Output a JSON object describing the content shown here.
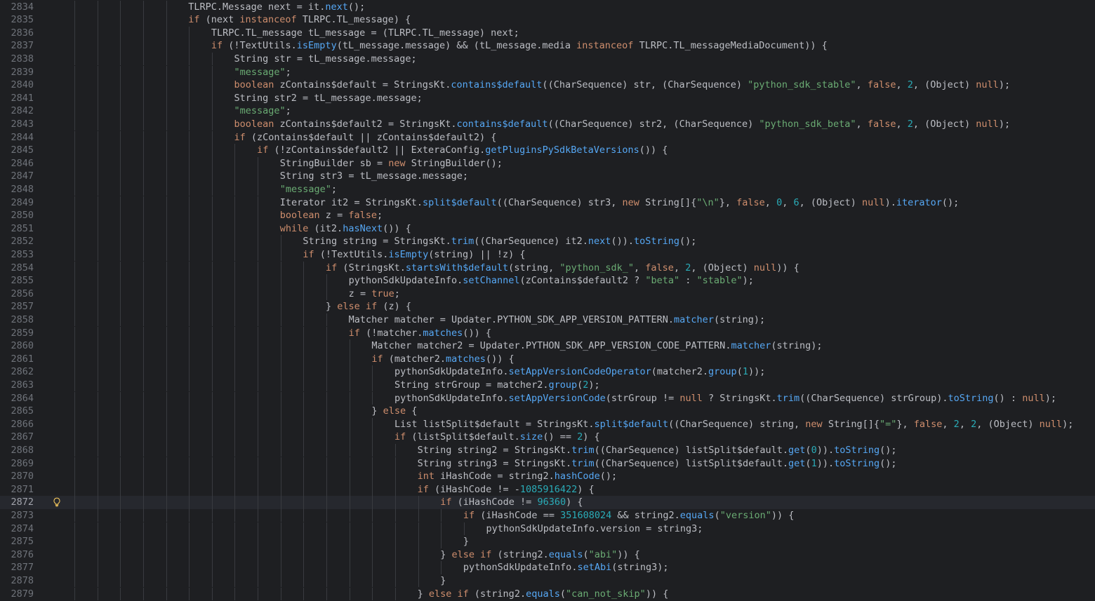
{
  "editor": {
    "current_line": 2872,
    "lines": [
      {
        "n": "2834",
        "indent": 5,
        "code": "TLRPC.Message next = it.next();"
      },
      {
        "n": "2835",
        "indent": 5,
        "code": "if (next instanceof TLRPC.TL_message) {"
      },
      {
        "n": "2836",
        "indent": 6,
        "code": "TLRPC.TL_message tL_message = (TLRPC.TL_message) next;"
      },
      {
        "n": "2837",
        "indent": 6,
        "code": "if (!TextUtils.isEmpty(tL_message.message) && (tL_message.media instanceof TLRPC.TL_messageMediaDocument)) {"
      },
      {
        "n": "2838",
        "indent": 7,
        "code": "String str = tL_message.message;"
      },
      {
        "n": "2839",
        "indent": 7,
        "code": "\"message\";"
      },
      {
        "n": "2840",
        "indent": 7,
        "code": "boolean zContains$default = StringsKt.contains$default((CharSequence) str, (CharSequence) \"python_sdk_stable\", false, 2, (Object) null);"
      },
      {
        "n": "2841",
        "indent": 7,
        "code": "String str2 = tL_message.message;"
      },
      {
        "n": "2842",
        "indent": 7,
        "code": "\"message\";"
      },
      {
        "n": "2843",
        "indent": 7,
        "code": "boolean zContains$default2 = StringsKt.contains$default((CharSequence) str2, (CharSequence) \"python_sdk_beta\", false, 2, (Object) null);"
      },
      {
        "n": "2844",
        "indent": 7,
        "code": "if (zContains$default || zContains$default2) {"
      },
      {
        "n": "2845",
        "indent": 8,
        "code": "if (!zContains$default2 || ExteraConfig.getPluginsPySdkBetaVersions()) {"
      },
      {
        "n": "2846",
        "indent": 9,
        "code": "StringBuilder sb = new StringBuilder();"
      },
      {
        "n": "2847",
        "indent": 9,
        "code": "String str3 = tL_message.message;"
      },
      {
        "n": "2848",
        "indent": 9,
        "code": "\"message\";"
      },
      {
        "n": "2849",
        "indent": 9,
        "code": "Iterator it2 = StringsKt.split$default((CharSequence) str3, new String[]{\"\\n\"}, false, 0, 6, (Object) null).iterator();"
      },
      {
        "n": "2850",
        "indent": 9,
        "code": "boolean z = false;"
      },
      {
        "n": "2851",
        "indent": 9,
        "code": "while (it2.hasNext()) {"
      },
      {
        "n": "2852",
        "indent": 10,
        "code": "String string = StringsKt.trim((CharSequence) it2.next()).toString();"
      },
      {
        "n": "2853",
        "indent": 10,
        "code": "if (!TextUtils.isEmpty(string) || !z) {"
      },
      {
        "n": "2854",
        "indent": 11,
        "code": "if (StringsKt.startsWith$default(string, \"python_sdk_\", false, 2, (Object) null)) {"
      },
      {
        "n": "2855",
        "indent": 12,
        "code": "pythonSdkUpdateInfo.setChannel(zContains$default2 ? \"beta\" : \"stable\");"
      },
      {
        "n": "2856",
        "indent": 12,
        "code": "z = true;"
      },
      {
        "n": "2857",
        "indent": 11,
        "code": "} else if (z) {"
      },
      {
        "n": "2858",
        "indent": 12,
        "code": "Matcher matcher = Updater.PYTHON_SDK_APP_VERSION_PATTERN.matcher(string);"
      },
      {
        "n": "2859",
        "indent": 12,
        "code": "if (!matcher.matches()) {"
      },
      {
        "n": "2860",
        "indent": 13,
        "code": "Matcher matcher2 = Updater.PYTHON_SDK_APP_VERSION_CODE_PATTERN.matcher(string);"
      },
      {
        "n": "2861",
        "indent": 13,
        "code": "if (matcher2.matches()) {"
      },
      {
        "n": "2862",
        "indent": 14,
        "code": "pythonSdkUpdateInfo.setAppVersionCodeOperator(matcher2.group(1));"
      },
      {
        "n": "2863",
        "indent": 14,
        "code": "String strGroup = matcher2.group(2);"
      },
      {
        "n": "2864",
        "indent": 14,
        "code": "pythonSdkUpdateInfo.setAppVersionCode(strGroup != null ? StringsKt.trim((CharSequence) strGroup).toString() : null);"
      },
      {
        "n": "2865",
        "indent": 13,
        "code": "} else {"
      },
      {
        "n": "2866",
        "indent": 14,
        "code": "List listSplit$default = StringsKt.split$default((CharSequence) string, new String[]{\"=\"}, false, 2, 2, (Object) null);"
      },
      {
        "n": "2867",
        "indent": 14,
        "code": "if (listSplit$default.size() == 2) {"
      },
      {
        "n": "2868",
        "indent": 15,
        "code": "String string2 = StringsKt.trim((CharSequence) listSplit$default.get(0)).toString();"
      },
      {
        "n": "2869",
        "indent": 15,
        "code": "String string3 = StringsKt.trim((CharSequence) listSplit$default.get(1)).toString();"
      },
      {
        "n": "2870",
        "indent": 15,
        "code": "int iHashCode = string2.hashCode();"
      },
      {
        "n": "2871",
        "indent": 15,
        "code": "if (iHashCode != -1085916422) {"
      },
      {
        "n": "2872",
        "indent": 16,
        "code": "if (iHashCode != 96360) {"
      },
      {
        "n": "2873",
        "indent": 17,
        "code": "if (iHashCode == 351608024 && string2.equals(\"version\")) {"
      },
      {
        "n": "2874",
        "indent": 18,
        "code": "pythonSdkUpdateInfo.version = string3;"
      },
      {
        "n": "2875",
        "indent": 17,
        "code": "}"
      },
      {
        "n": "2876",
        "indent": 16,
        "code": "} else if (string2.equals(\"abi\")) {"
      },
      {
        "n": "2877",
        "indent": 17,
        "code": "pythonSdkUpdateInfo.setAbi(string3);"
      },
      {
        "n": "2878",
        "indent": 16,
        "code": "}"
      },
      {
        "n": "2879",
        "indent": 15,
        "code": "} else if (string2.equals(\"can_not_skip\")) {"
      }
    ]
  },
  "gutter": {
    "current_line_icon": "lightbulb-icon"
  },
  "colors": {
    "background": "#1e1f22",
    "current_line": "#26282e",
    "keyword": "#cf8e6d",
    "string": "#6aab73",
    "number": "#2aacb8",
    "method": "#56a8f5",
    "text": "#bcbec4",
    "line_number": "#6f737a",
    "bulb": "#f2c55c"
  }
}
